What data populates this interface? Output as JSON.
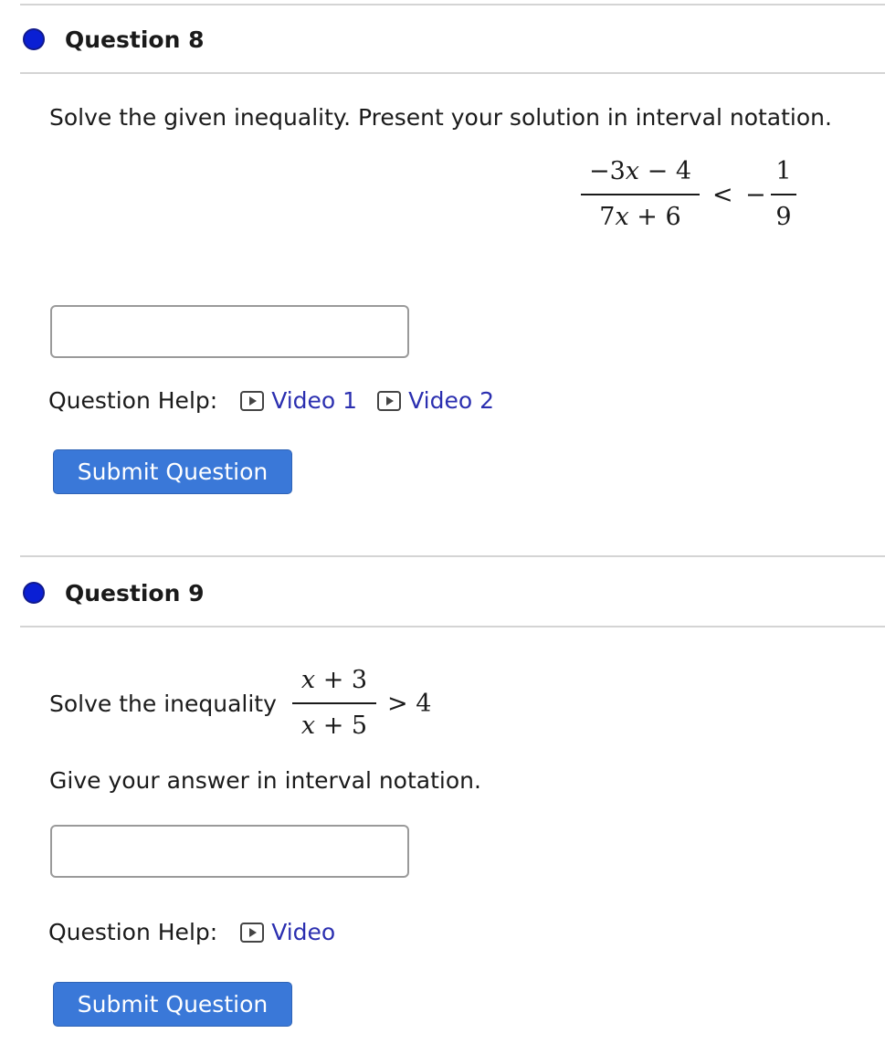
{
  "q8": {
    "title": "Question 8",
    "prompt": "Solve the given inequality. Present your solution in interval notation.",
    "lhs_num_pre": "−3",
    "lhs_num_var": "x",
    "lhs_num_post": " − 4",
    "lhs_den_pre": "7",
    "lhs_den_var": "x",
    "lhs_den_post": " + 6",
    "operator": "<",
    "rhs_sign": "−",
    "rhs_num": "1",
    "rhs_den": "9",
    "answer_value": "",
    "help_label": "Question Help:",
    "videos": [
      "Video 1",
      "Video 2"
    ],
    "submit_label": "Submit Question"
  },
  "q9": {
    "title": "Question 9",
    "prompt": "Solve the inequality",
    "num_var": "x",
    "num_post": " + 3",
    "den_var": "x",
    "den_post": " + 5",
    "operator": "> 4",
    "instruction": "Give your answer in interval notation.",
    "answer_value": "",
    "help_label": "Question Help:",
    "videos": [
      "Video"
    ],
    "submit_label": "Submit Question"
  },
  "colors": {
    "dot": "#0a1fd4",
    "link": "#2b2fb0",
    "button": "#3a78d8"
  },
  "icons": [
    "question-dot-icon",
    "play-video-icon"
  ]
}
